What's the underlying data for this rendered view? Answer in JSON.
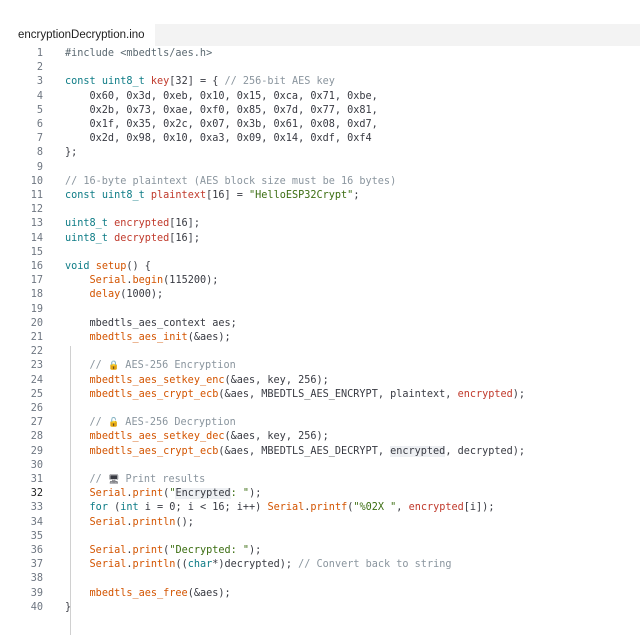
{
  "tab": {
    "title": "encryptionDecryption.ino"
  },
  "editor": {
    "active_line": 32,
    "lines": [
      {
        "n": "1",
        "t": [
          {
            "c": "pp",
            "v": "#include <mbedtls/aes.h>"
          }
        ]
      },
      {
        "n": "2",
        "t": []
      },
      {
        "n": "3",
        "t": [
          {
            "c": "kw",
            "v": "const"
          },
          {
            "c": "",
            "v": " "
          },
          {
            "c": "ty",
            "v": "uint8_t"
          },
          {
            "c": "",
            "v": " "
          },
          {
            "c": "va",
            "v": "key"
          },
          {
            "c": "",
            "v": "[32] = { "
          },
          {
            "c": "cm",
            "v": "// 256-bit AES key"
          }
        ]
      },
      {
        "n": "4",
        "t": [
          {
            "c": "",
            "v": "    0x60, 0x3d, 0xeb, 0x10, 0x15, 0xca, 0x71, 0xbe,"
          }
        ]
      },
      {
        "n": "5",
        "t": [
          {
            "c": "",
            "v": "    0x2b, 0x73, 0xae, 0xf0, 0x85, 0x7d, 0x77, 0x81,"
          }
        ]
      },
      {
        "n": "6",
        "t": [
          {
            "c": "",
            "v": "    0x1f, 0x35, 0x2c, 0x07, 0x3b, 0x61, 0x08, 0xd7,"
          }
        ]
      },
      {
        "n": "7",
        "t": [
          {
            "c": "",
            "v": "    0x2d, 0x98, 0x10, 0xa3, 0x09, 0x14, 0xdf, 0xf4"
          }
        ]
      },
      {
        "n": "8",
        "t": [
          {
            "c": "",
            "v": "};"
          }
        ]
      },
      {
        "n": "9",
        "t": []
      },
      {
        "n": "10",
        "t": [
          {
            "c": "cm",
            "v": "// 16-byte plaintext (AES block size must be 16 bytes)"
          }
        ]
      },
      {
        "n": "11",
        "t": [
          {
            "c": "kw",
            "v": "const"
          },
          {
            "c": "",
            "v": " "
          },
          {
            "c": "ty",
            "v": "uint8_t"
          },
          {
            "c": "",
            "v": " "
          },
          {
            "c": "va",
            "v": "plaintext"
          },
          {
            "c": "",
            "v": "[16] = "
          },
          {
            "c": "st",
            "v": "\"HelloESP32Crypt\""
          },
          {
            "c": "",
            "v": ";"
          }
        ]
      },
      {
        "n": "12",
        "t": []
      },
      {
        "n": "13",
        "t": [
          {
            "c": "ty",
            "v": "uint8_t"
          },
          {
            "c": "",
            "v": " "
          },
          {
            "c": "va",
            "v": "encrypted"
          },
          {
            "c": "",
            "v": "[16];"
          }
        ]
      },
      {
        "n": "14",
        "t": [
          {
            "c": "ty",
            "v": "uint8_t"
          },
          {
            "c": "",
            "v": " "
          },
          {
            "c": "va",
            "v": "decrypted"
          },
          {
            "c": "",
            "v": "[16];"
          }
        ]
      },
      {
        "n": "15",
        "t": []
      },
      {
        "n": "16",
        "t": [
          {
            "c": "ty",
            "v": "void"
          },
          {
            "c": "",
            "v": " "
          },
          {
            "c": "fn",
            "v": "setup"
          },
          {
            "c": "",
            "v": "() {"
          }
        ]
      },
      {
        "n": "17",
        "t": [
          {
            "c": "",
            "v": "    "
          },
          {
            "c": "fn",
            "v": "Serial"
          },
          {
            "c": "",
            "v": "."
          },
          {
            "c": "fn",
            "v": "begin"
          },
          {
            "c": "",
            "v": "(115200);"
          }
        ]
      },
      {
        "n": "18",
        "t": [
          {
            "c": "",
            "v": "    "
          },
          {
            "c": "fn",
            "v": "delay"
          },
          {
            "c": "",
            "v": "(1000);"
          }
        ]
      },
      {
        "n": "19",
        "t": []
      },
      {
        "n": "20",
        "t": [
          {
            "c": "",
            "v": "    mbedtls_aes_context aes;"
          }
        ]
      },
      {
        "n": "21",
        "t": [
          {
            "c": "",
            "v": "    "
          },
          {
            "c": "fn",
            "v": "mbedtls_aes_init"
          },
          {
            "c": "",
            "v": "(&aes);"
          }
        ]
      },
      {
        "n": "22",
        "t": []
      },
      {
        "n": "23",
        "t": [
          {
            "c": "",
            "v": "    "
          },
          {
            "c": "cm",
            "v": "// "
          },
          {
            "c": "emoji",
            "v": "🔒"
          },
          {
            "c": "cm",
            "v": " AES-256 Encryption"
          }
        ]
      },
      {
        "n": "24",
        "t": [
          {
            "c": "",
            "v": "    "
          },
          {
            "c": "fn",
            "v": "mbedtls_aes_setkey_enc"
          },
          {
            "c": "",
            "v": "(&aes, key, 256);"
          }
        ]
      },
      {
        "n": "25",
        "t": [
          {
            "c": "",
            "v": "    "
          },
          {
            "c": "fn",
            "v": "mbedtls_aes_crypt_ecb"
          },
          {
            "c": "",
            "v": "(&aes, MBEDTLS_AES_ENCRYPT, plaintext, "
          },
          {
            "c": "va",
            "v": "encrypted"
          },
          {
            "c": "",
            "v": ");"
          }
        ]
      },
      {
        "n": "26",
        "t": []
      },
      {
        "n": "27",
        "t": [
          {
            "c": "",
            "v": "    "
          },
          {
            "c": "cm",
            "v": "// "
          },
          {
            "c": "emoji",
            "v": "🔓"
          },
          {
            "c": "cm",
            "v": " AES-256 Decryption"
          }
        ]
      },
      {
        "n": "28",
        "t": [
          {
            "c": "",
            "v": "    "
          },
          {
            "c": "fn",
            "v": "mbedtls_aes_setkey_dec"
          },
          {
            "c": "",
            "v": "(&aes, key, 256);"
          }
        ]
      },
      {
        "n": "29",
        "t": [
          {
            "c": "",
            "v": "    "
          },
          {
            "c": "fn",
            "v": "mbedtls_aes_crypt_ecb"
          },
          {
            "c": "",
            "v": "(&aes, MBEDTLS_AES_DECRYPT, "
          },
          {
            "c": "hl",
            "v": "encrypted"
          },
          {
            "c": "",
            "v": ", decrypted);"
          }
        ]
      },
      {
        "n": "30",
        "t": []
      },
      {
        "n": "31",
        "t": [
          {
            "c": "",
            "v": "    "
          },
          {
            "c": "cm",
            "v": "// "
          },
          {
            "c": "emoji",
            "v": "🖥"
          },
          {
            "c": "cm",
            "v": " Print results"
          }
        ]
      },
      {
        "n": "32",
        "t": [
          {
            "c": "",
            "v": "    "
          },
          {
            "c": "fn",
            "v": "Serial"
          },
          {
            "c": "",
            "v": "."
          },
          {
            "c": "fn",
            "v": "print"
          },
          {
            "c": "",
            "v": "("
          },
          {
            "c": "st",
            "v": "\""
          },
          {
            "c": "hl",
            "v": "Encrypted"
          },
          {
            "c": "st",
            "v": ": \""
          },
          {
            "c": "",
            "v": ");"
          }
        ]
      },
      {
        "n": "33",
        "t": [
          {
            "c": "",
            "v": "    "
          },
          {
            "c": "kw",
            "v": "for"
          },
          {
            "c": "",
            "v": " ("
          },
          {
            "c": "ty",
            "v": "int"
          },
          {
            "c": "",
            "v": " i = 0; i < 16; i++) "
          },
          {
            "c": "fn",
            "v": "Serial"
          },
          {
            "c": "",
            "v": "."
          },
          {
            "c": "fn",
            "v": "printf"
          },
          {
            "c": "",
            "v": "("
          },
          {
            "c": "st",
            "v": "\"%02X \""
          },
          {
            "c": "",
            "v": ", "
          },
          {
            "c": "va",
            "v": "encrypted"
          },
          {
            "c": "",
            "v": "[i]);"
          }
        ]
      },
      {
        "n": "34",
        "t": [
          {
            "c": "",
            "v": "    "
          },
          {
            "c": "fn",
            "v": "Serial"
          },
          {
            "c": "",
            "v": "."
          },
          {
            "c": "fn",
            "v": "println"
          },
          {
            "c": "",
            "v": "();"
          }
        ]
      },
      {
        "n": "35",
        "t": []
      },
      {
        "n": "36",
        "t": [
          {
            "c": "",
            "v": "    "
          },
          {
            "c": "fn",
            "v": "Serial"
          },
          {
            "c": "",
            "v": "."
          },
          {
            "c": "fn",
            "v": "print"
          },
          {
            "c": "",
            "v": "("
          },
          {
            "c": "st",
            "v": "\"Decrypted: \""
          },
          {
            "c": "",
            "v": ");"
          }
        ]
      },
      {
        "n": "37",
        "t": [
          {
            "c": "",
            "v": "    "
          },
          {
            "c": "fn",
            "v": "Serial"
          },
          {
            "c": "",
            "v": "."
          },
          {
            "c": "fn",
            "v": "println"
          },
          {
            "c": "",
            "v": "(("
          },
          {
            "c": "ty",
            "v": "char"
          },
          {
            "c": "",
            "v": "*)decrypted); "
          },
          {
            "c": "cm",
            "v": "// Convert back to string"
          }
        ]
      },
      {
        "n": "38",
        "t": []
      },
      {
        "n": "39",
        "t": [
          {
            "c": "",
            "v": "    "
          },
          {
            "c": "fn",
            "v": "mbedtls_aes_free"
          },
          {
            "c": "",
            "v": "(&aes);"
          }
        ]
      },
      {
        "n": "40",
        "t": [
          {
            "c": "",
            "v": "}"
          }
        ]
      }
    ]
  }
}
